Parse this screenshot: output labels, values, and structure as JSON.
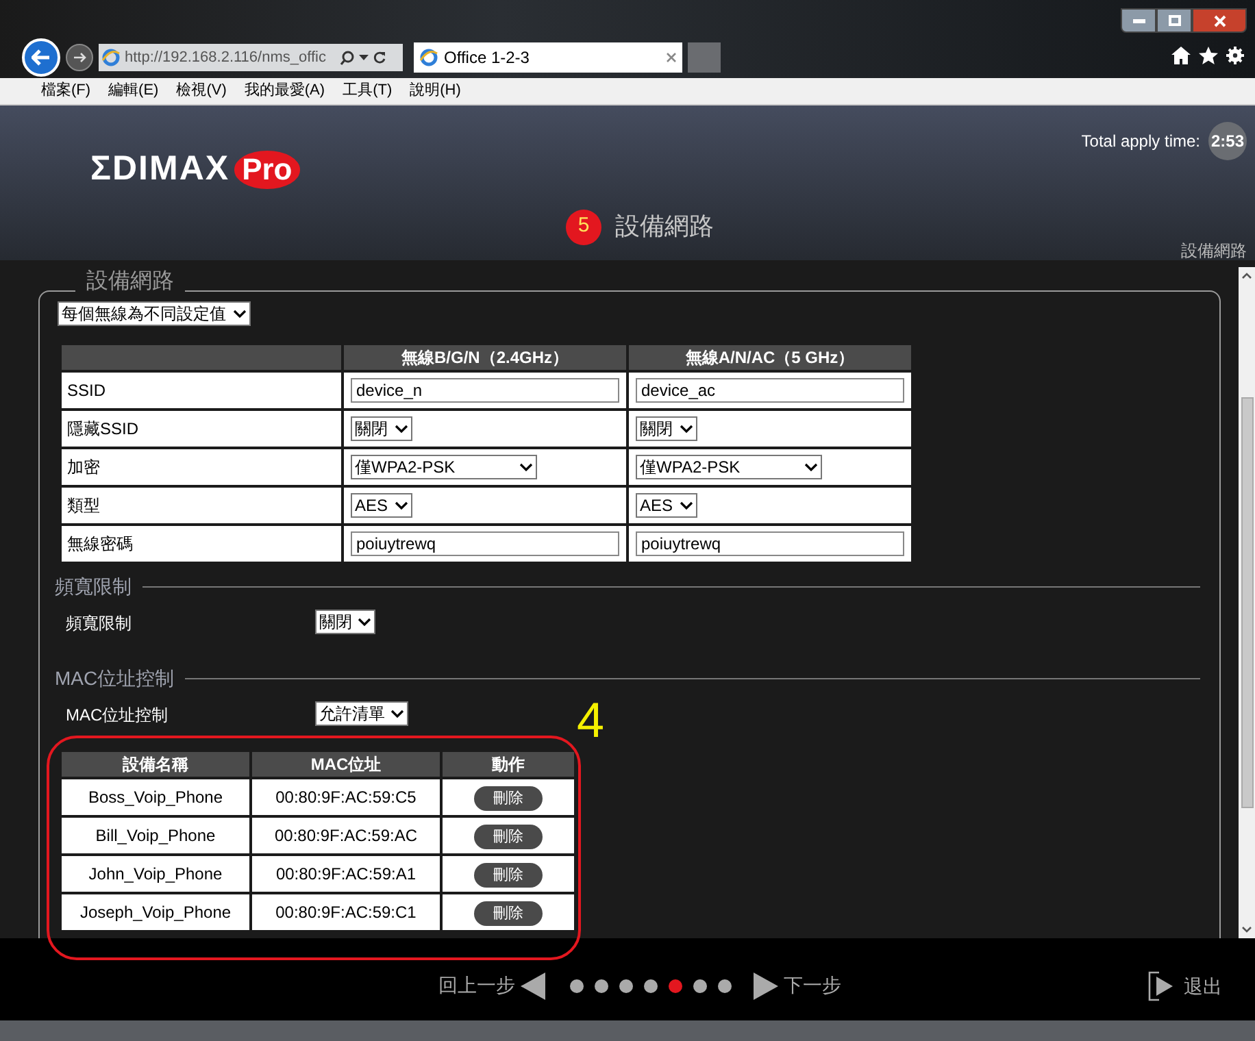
{
  "browser": {
    "url": "http://192.168.2.116/nms_offic",
    "tab_title": "Office 1-2-3",
    "menu": [
      "檔案(F)",
      "編輯(E)",
      "檢視(V)",
      "我的最愛(A)",
      "工具(T)",
      "說明(H)"
    ]
  },
  "header": {
    "logo": "ΣDIMAX",
    "logo_badge": "Pro",
    "apply_time_label": "Total apply time:",
    "apply_time": "2:53",
    "step_number": "5",
    "step_title": "設備網路",
    "breadcrumb": "設備網路"
  },
  "section": {
    "legend": "設備網路",
    "mode_select": "每個無線為不同設定值"
  },
  "wireless_table": {
    "columns": [
      "無線B/G/N（2.4GHz）",
      "無線A/N/AC（5 GHz）"
    ],
    "rows": [
      {
        "label": "SSID",
        "kind": "input",
        "values": [
          "device_n",
          "device_ac"
        ]
      },
      {
        "label": "隱藏SSID",
        "kind": "select",
        "values": [
          "關閉",
          "關閉"
        ]
      },
      {
        "label": "加密",
        "kind": "wide-select",
        "values": [
          "僅WPA2-PSK",
          "僅WPA2-PSK"
        ]
      },
      {
        "label": "類型",
        "kind": "select",
        "values": [
          "AES",
          "AES"
        ]
      },
      {
        "label": "無線密碼",
        "kind": "input",
        "values": [
          "poiuytrewq",
          "poiuytrewq"
        ]
      }
    ]
  },
  "bandwidth": {
    "title": "頻寬限制",
    "label": "頻寬限制",
    "value": "關閉"
  },
  "mac_control": {
    "title": "MAC位址控制",
    "label": "MAC位址控制",
    "value": "允許清單",
    "columns": [
      "設備名稱",
      "MAC位址",
      "動作"
    ],
    "rows": [
      {
        "name": "Boss_Voip_Phone",
        "mac": "00:80:9F:AC:59:C5",
        "action": "刪除"
      },
      {
        "name": "Bill_Voip_Phone",
        "mac": "00:80:9F:AC:59:AC",
        "action": "刪除"
      },
      {
        "name": "John_Voip_Phone",
        "mac": "00:80:9F:AC:59:A1",
        "action": "刪除"
      },
      {
        "name": "Joseph_Voip_Phone",
        "mac": "00:80:9F:AC:59:C1",
        "action": "刪除"
      }
    ]
  },
  "annotation": {
    "label": "4"
  },
  "footer": {
    "back": "回上一步",
    "next": "下一步",
    "exit": "退出",
    "dots": [
      {
        "selected": false
      },
      {
        "selected": false
      },
      {
        "selected": false
      },
      {
        "selected": false
      },
      {
        "selected": true
      },
      {
        "selected": false
      },
      {
        "selected": false
      }
    ]
  }
}
